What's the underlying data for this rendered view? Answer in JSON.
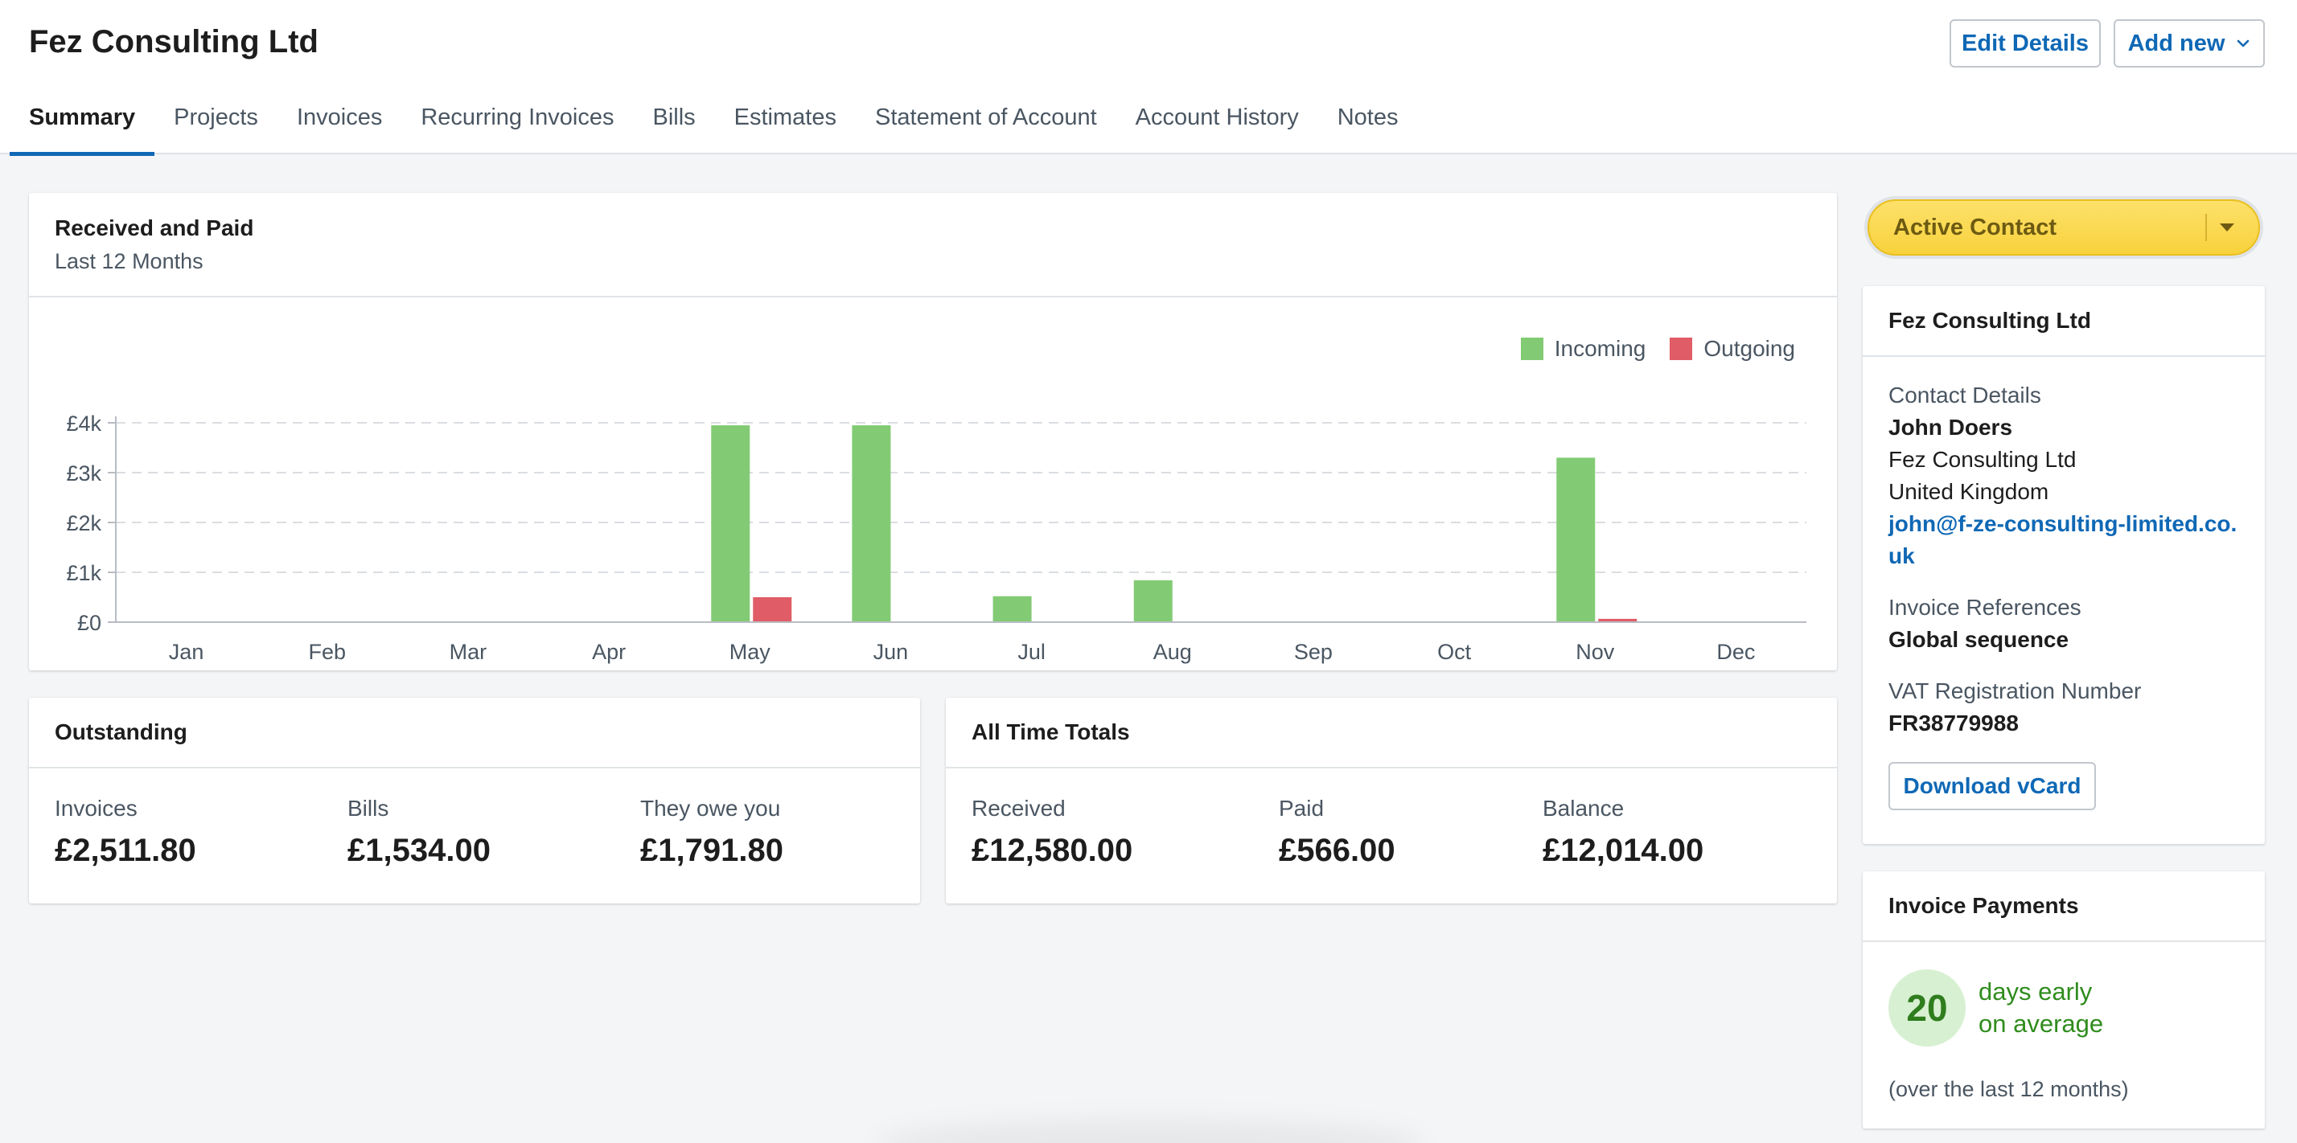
{
  "header": {
    "title": "Fez Consulting Ltd",
    "edit_label": "Edit Details",
    "add_label": "Add new"
  },
  "tabs": [
    {
      "label": "Summary",
      "active": true
    },
    {
      "label": "Projects"
    },
    {
      "label": "Invoices"
    },
    {
      "label": "Recurring Invoices"
    },
    {
      "label": "Bills"
    },
    {
      "label": "Estimates"
    },
    {
      "label": "Statement of Account"
    },
    {
      "label": "Account History"
    },
    {
      "label": "Notes"
    }
  ],
  "chart_card": {
    "title": "Received and Paid",
    "subtitle": "Last 12 Months"
  },
  "chart_data": {
    "type": "bar",
    "categories": [
      "Jan",
      "Feb",
      "Mar",
      "Apr",
      "May",
      "Jun",
      "Jul",
      "Aug",
      "Sep",
      "Oct",
      "Nov",
      "Dec"
    ],
    "series": [
      {
        "name": "Incoming",
        "color": "#82cb74",
        "values": [
          0,
          0,
          0,
          0,
          3950,
          3950,
          520,
          840,
          0,
          0,
          3300,
          0
        ]
      },
      {
        "name": "Outgoing",
        "color": "#e05c66",
        "values": [
          0,
          0,
          0,
          0,
          500,
          0,
          0,
          0,
          0,
          0,
          66,
          0
        ]
      }
    ],
    "yticks": [
      0,
      1000,
      2000,
      3000,
      4000
    ],
    "ytick_labels": [
      "£0",
      "£1k",
      "£2k",
      "£3k",
      "£4k"
    ],
    "ylim": [
      0,
      4000
    ],
    "grid": true,
    "legend": "top-right"
  },
  "outstanding": {
    "title": "Outstanding",
    "items": [
      {
        "label": "Invoices",
        "value": "£2,511.80"
      },
      {
        "label": "Bills",
        "value": "£1,534.00"
      },
      {
        "label": "They owe you",
        "value": "£1,791.80"
      }
    ]
  },
  "all_time": {
    "title": "All Time Totals",
    "items": [
      {
        "label": "Received",
        "value": "£12,580.00"
      },
      {
        "label": "Paid",
        "value": "£566.00"
      },
      {
        "label": "Balance",
        "value": "£12,014.00"
      }
    ]
  },
  "status": {
    "label": "Active Contact",
    "color": "#f8d23c"
  },
  "contact": {
    "title": "Fez Consulting Ltd",
    "details_label": "Contact Details",
    "name": "John Doers",
    "company": "Fez Consulting Ltd",
    "country": "United Kingdom",
    "email": "john@f-ze-consulting-limited.co.uk",
    "invoice_ref_label": "Invoice References",
    "invoice_ref": "Global sequence",
    "vat_label": "VAT Registration Number",
    "vat": "FR38779988",
    "vcard_label": "Download vCard"
  },
  "payments": {
    "title": "Invoice Payments",
    "days": "20",
    "line1": "days early",
    "line2": "on average",
    "note": "(over the last 12 months)"
  }
}
